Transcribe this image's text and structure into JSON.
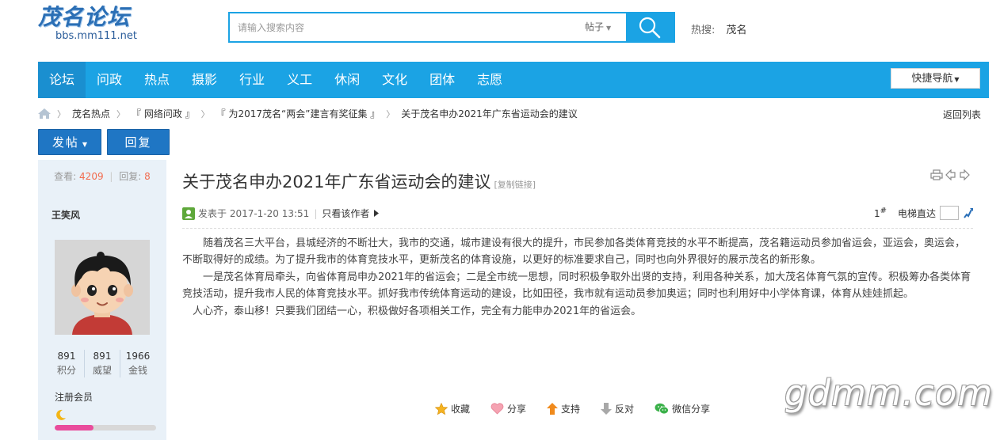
{
  "header": {
    "logo_title": "茂名论坛",
    "logo_url": "bbs.mm111.net",
    "search_placeholder": "请输入搜索内容",
    "search_type": "帖子",
    "hot_label": "热搜:",
    "hot_keyword": "茂名"
  },
  "nav": {
    "items": [
      "论坛",
      "问政",
      "热点",
      "摄影",
      "行业",
      "义工",
      "休闲",
      "文化",
      "团体",
      "志愿"
    ],
    "quick_nav": "快捷导航"
  },
  "breadcrumb": {
    "items": [
      "茂名热点",
      "『 网络问政 』",
      "『 为2017茂名“两会”建言有奖征集 』",
      "关于茂名申办2021年广东省运动会的建议"
    ],
    "back_list": "返回列表"
  },
  "actions": {
    "post": "发帖",
    "reply": "回复"
  },
  "author": {
    "views_label": "查看:",
    "views": "4209",
    "replies_label": "回复:",
    "replies": "8",
    "name": "王笑风",
    "score": [
      {
        "value": "891",
        "label": "积分"
      },
      {
        "value": "891",
        "label": "威望"
      },
      {
        "value": "1966",
        "label": "金钱"
      }
    ],
    "group": "注册会员",
    "level_progress": 0.38,
    "level_color": "#e94c9c"
  },
  "thread": {
    "title": "关于茂名申办2021年广东省运动会的建议",
    "copy_link": "[复制链接]",
    "posted_at": "发表于 2017-1-20 13:51",
    "only_author": "只看该作者",
    "floor_number": "1",
    "floor_mark": "#",
    "jump_label": "电梯直达",
    "paragraphs": [
      "随着茂名三大平台，县城经济的不断壮大，我市的交通，城市建设有很大的提升，市民参加各类体育竞技的水平不断提高，茂名籍运动员参加省运会，亚运会，奥运会，不断取得好的成绩。为了提升我市的体育竞技水平，更新茂名的体育设施，以更好的标准要求自己，同时也向外界很好的展示茂名的新形象。",
      "一是茂名体育局牵头，向省体育局申办2021年的省运会；二是全市统一思想，同时积极争取外出贤的支持，利用各种关系，加大茂名体育气氛的宣传。积极筹办各类体育竞技活动，提升我市人民的体育竞技水平。抓好我市传统体育运动的建设，比如田径，我市就有运动员参加奥运；同时也利用好中小学体育课，体育从娃娃抓起。",
      "人心齐，泰山移！只要我们团结一心，积极做好各项相关工作，完全有力能申办2021年的省运会。"
    ]
  },
  "reactions": {
    "favorite": "收藏",
    "share": "分享",
    "support": "支持",
    "oppose": "反对",
    "wechat_share": "微信分享"
  },
  "watermark": "gdmm.com",
  "colors": {
    "nav": "#1ba3e4",
    "button": "#1f76c4",
    "accent_number": "#f26c4f"
  }
}
